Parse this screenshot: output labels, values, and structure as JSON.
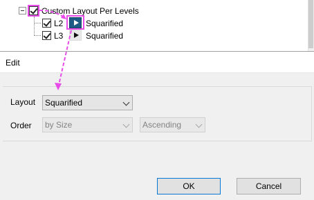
{
  "tree": {
    "root": {
      "label": "Custom Layout Per Levels",
      "checked": true,
      "expanded": true
    },
    "levels": [
      {
        "level": "L2",
        "checked": true,
        "layout": "Squarified",
        "icon": "play-icon",
        "selected": true
      },
      {
        "level": "L3",
        "checked": true,
        "layout": "Squarified",
        "icon": "play-icon",
        "selected": false
      }
    ]
  },
  "dialog": {
    "title": "Edit",
    "layout": {
      "label": "Layout",
      "value": "Squarified"
    },
    "order": {
      "label": "Order",
      "by_value": "by Size",
      "direction_value": "Ascending",
      "disabled": true
    },
    "ok_label": "OK",
    "cancel_label": "Cancel"
  },
  "colors": {
    "highlight": "#e84ce8",
    "selected_icon_bg": "#1e5a86"
  }
}
